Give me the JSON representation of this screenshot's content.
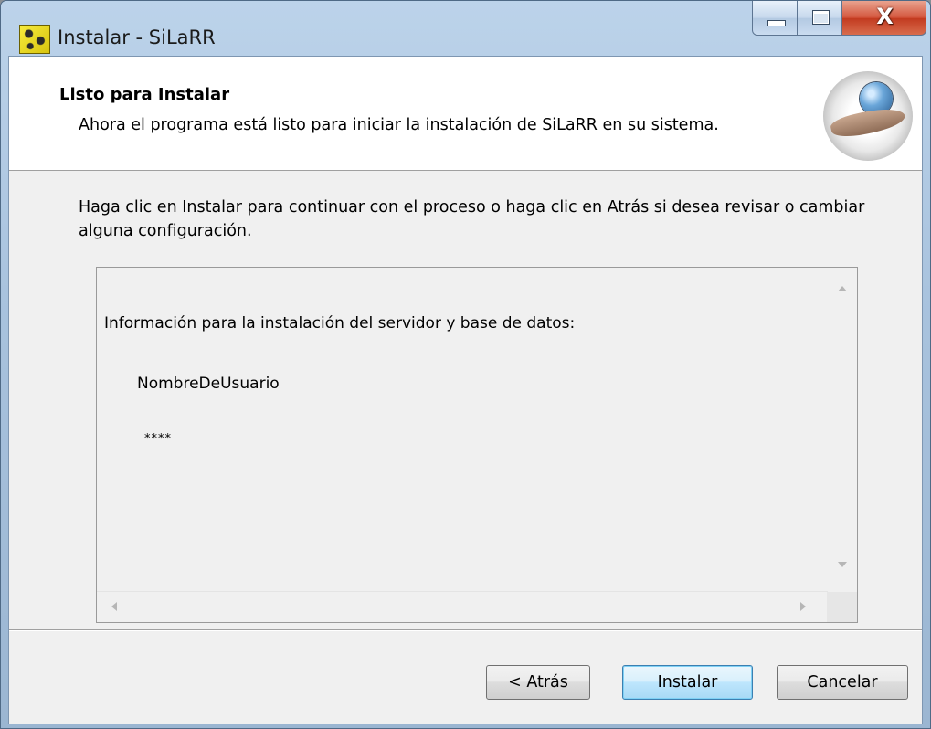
{
  "window": {
    "title": "Instalar - SiLaRR",
    "controls": {
      "minimize": "minimize",
      "maximize": "maximize",
      "close": "X"
    }
  },
  "header": {
    "title": "Listo para Instalar",
    "subtitle": "Ahora el programa está listo para iniciar la instalación de SiLaRR en su sistema."
  },
  "body": {
    "instructions": "Haga clic en Instalar para continuar con el proceso o haga clic en Atrás si desea revisar o cambiar alguna configuración."
  },
  "memo": {
    "heading": "Información para la instalación del servidor y base de datos:",
    "username": "NombreDeUsuario",
    "password": "****"
  },
  "buttons": {
    "back": "< Atrás",
    "install": "Instalar",
    "cancel": "Cancelar"
  },
  "icons": {
    "app": "silarr-app-icon",
    "header": "globe-in-hand-icon"
  }
}
